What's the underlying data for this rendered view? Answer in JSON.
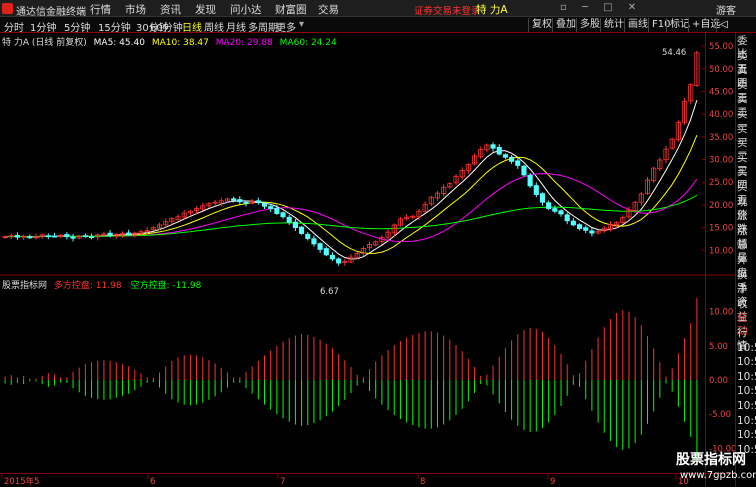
{
  "menubar": {
    "app_title": "通达信金融终端",
    "items": [
      "行情",
      "市场",
      "资讯",
      "发现",
      "问小达",
      "财富圈",
      "交易"
    ],
    "notice": "证券交易未登录",
    "stock_name": "特 力A",
    "guest_label": "游客",
    "window_controls": "▫ ─ □ ✕"
  },
  "periodbar": {
    "periods": [
      "分时",
      "1分钟",
      "5分钟",
      "15分钟",
      "30分钟",
      "60分钟",
      "日线",
      "周线",
      "月线",
      "多周期",
      "更多"
    ],
    "active": "日线",
    "tools": [
      "复权",
      "叠加",
      "多股",
      "统计",
      "画线",
      "F10",
      "标记",
      "+自选"
    ],
    "back_icon": "◁"
  },
  "main_chart": {
    "title": "特 力A (日线 前复权)",
    "ma_labels": [
      {
        "text": "MA5: 45.40",
        "color": "#ffffff"
      },
      {
        "text": "MA10: 38.47",
        "color": "#ffff00"
      },
      {
        "text": "MA20: 29.88",
        "color": "#ff00ff"
      },
      {
        "text": "MA60: 24.24",
        "color": "#00ff00"
      }
    ],
    "y_ticks": [
      "55.00",
      "50.00",
      "45.00",
      "40.00",
      "35.00",
      "30.00",
      "25.00",
      "20.00",
      "15.00",
      "10.00"
    ],
    "high_label": "54.46",
    "low_label": "6.67"
  },
  "indicator": {
    "name": "股票指标网",
    "long_label": "多方控盘: 11.98",
    "short_label": "空方控盘: -11.98",
    "y_ticks": [
      "10.00",
      "5.00",
      "0.00",
      "-5.00",
      "-10.00"
    ]
  },
  "xaxis": [
    "2015年5",
    "6",
    "7",
    "8",
    "9",
    "10"
  ],
  "right_panel": {
    "labels": [
      "委比",
      "卖五",
      "卖四",
      "卖三",
      "卖二",
      "卖一",
      "买一",
      "买二",
      "买三",
      "买四",
      "买五",
      "现价",
      "涨跌",
      "涨幅",
      "总量",
      "外盘",
      "换手",
      "净资",
      "收益",
      "自动",
      "行情",
      "10:50",
      "10:50",
      "10:51",
      "10:51",
      "10:51",
      "10:52",
      "10:52",
      "10:52"
    ]
  },
  "watermark": {
    "text": "股票指标网",
    "url": "www.7gpzb.com"
  },
  "chart_data": {
    "type": "candlestick",
    "y_range": [
      5,
      57
    ],
    "closes": [
      13.0,
      13.2,
      12.9,
      13.1,
      12.8,
      13.0,
      13.4,
      13.2,
      13.1,
      13.3,
      13.0,
      12.7,
      13.1,
      13.2,
      13.0,
      13.4,
      13.6,
      13.3,
      13.5,
      13.7,
      13.5,
      13.8,
      14.1,
      14.4,
      15.0,
      15.6,
      16.3,
      17.0,
      17.4,
      18.2,
      18.6,
      19.2,
      19.8,
      20.3,
      20.6,
      20.9,
      21.3,
      21.0,
      20.7,
      20.4,
      20.8,
      20.5,
      19.7,
      19.2,
      18.1,
      17.4,
      16.2,
      15.0,
      13.7,
      12.6,
      11.4,
      10.2,
      9.0,
      8.1,
      7.2,
      7.6,
      8.5,
      9.3,
      10.4,
      11.3,
      11.9,
      12.8,
      14.0,
      15.6,
      16.9,
      17.3,
      17.5,
      18.6,
      20.1,
      21.7,
      22.6,
      23.9,
      24.7,
      26.3,
      27.6,
      28.9,
      30.8,
      32.2,
      33.2,
      32.5,
      31.2,
      30.5,
      29.6,
      28.7,
      26.6,
      24.2,
      22.3,
      20.6,
      19.2,
      18.6,
      18.0,
      16.5,
      15.6,
      14.8,
      14.4,
      13.8,
      14.2,
      14.9,
      15.7,
      16.1,
      17.2,
      18.9,
      20.6,
      22.4,
      25.5,
      28.1,
      29.9,
      32.3,
      34.5,
      38.2,
      42.8,
      46.5,
      53.5
    ],
    "ma5_last": 45.4,
    "ma10_last": 38.47,
    "ma20_last": 29.88,
    "ma60_last": 24.24,
    "indicator_series": [
      0.5,
      0.7,
      0.4,
      0.6,
      0.2,
      -0.2,
      -0.6,
      -1.0,
      -0.8,
      -0.4,
      0.4,
      1.2,
      1.8,
      2.3,
      2.6,
      2.8,
      2.9,
      2.8,
      2.6,
      2.3,
      2.0,
      1.5,
      1.0,
      0.4,
      -0.3,
      -1.1,
      -2.0,
      -2.8,
      -3.3,
      -3.6,
      -3.7,
      -3.6,
      -3.3,
      -2.9,
      -2.4,
      -1.8,
      -1.1,
      -0.4,
      0.4,
      1.2,
      2.0,
      2.8,
      3.6,
      4.3,
      5.0,
      5.6,
      6.1,
      6.5,
      6.7,
      6.6,
      6.3,
      5.9,
      5.3,
      4.6,
      3.8,
      2.9,
      1.9,
      0.8,
      -0.4,
      -1.6,
      -2.7,
      -3.6,
      -4.4,
      -5.1,
      -5.7,
      -6.2,
      -6.6,
      -6.9,
      -7.1,
      -7.1,
      -6.9,
      -6.5,
      -5.9,
      -5.1,
      -4.2,
      -3.1,
      -1.9,
      -0.6,
      0.8,
      2.1,
      3.4,
      4.7,
      5.8,
      6.7,
      7.3,
      7.6,
      7.5,
      7.0,
      6.2,
      5.1,
      3.8,
      2.3,
      0.7,
      -1.0,
      -2.8,
      -4.5,
      -6.2,
      -7.7,
      -8.9,
      -9.8,
      -10.2,
      -10.0,
      -9.2,
      -8.0,
      -6.4,
      -4.6,
      -2.6,
      -0.5,
      1.7,
      3.9,
      6.1,
      8.3,
      11.98
    ]
  }
}
